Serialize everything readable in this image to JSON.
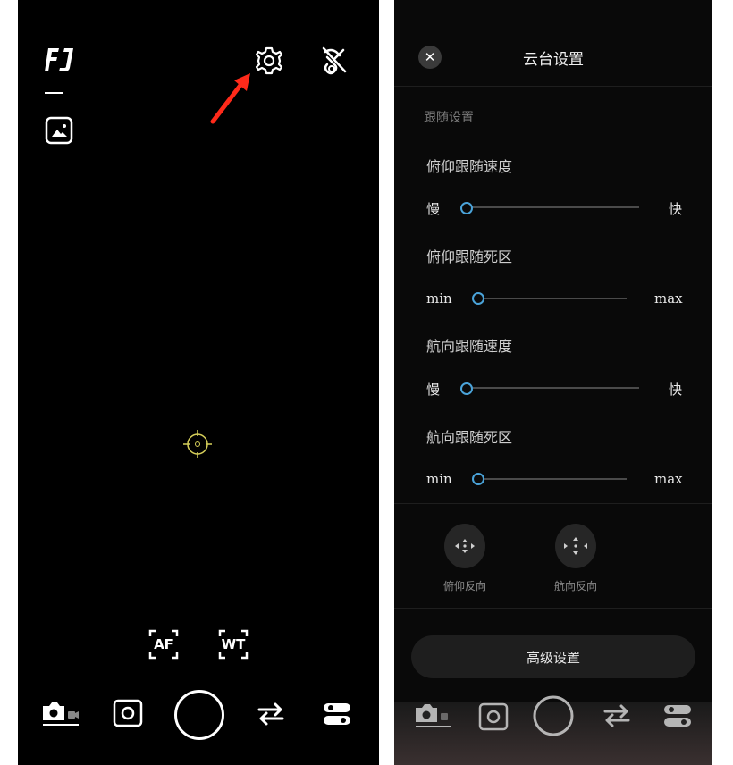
{
  "left_panel": {
    "logo_icon": "fj-logo-icon",
    "af_label": "AF",
    "wt_label": "WT",
    "icons": [
      "gallery-icon",
      "settings-gear-icon",
      "stabilizer-off-icon",
      "focus-reticle-icon",
      "camera-mode-icon",
      "square-record-icon",
      "shutter-icon",
      "switch-camera-icon",
      "toggles-icon"
    ],
    "annotation_color": "#ff2a1a",
    "focus_color": "#d6cf5a"
  },
  "gimbal_settings": {
    "title": "云台设置",
    "close_icon": "close-icon",
    "section_label": "跟随设置",
    "sliders": [
      {
        "label": "俯仰跟随速度",
        "min_label": "慢",
        "max_label": "快",
        "value": 0
      },
      {
        "label": "俯仰跟随死区",
        "min_label": "min",
        "max_label": "max",
        "value": 0
      },
      {
        "label": "航向跟随速度",
        "min_label": "慢",
        "max_label": "快",
        "value": 0
      },
      {
        "label": "航向跟随死区",
        "min_label": "min",
        "max_label": "max",
        "value": 0
      }
    ],
    "reverse_buttons": [
      {
        "label": "俯仰反向",
        "icon": "tilt-reverse-icon"
      },
      {
        "label": "航向反向",
        "icon": "pan-reverse-icon"
      }
    ],
    "advanced_button": "高级设置",
    "accent_color": "#4aa3d9"
  }
}
